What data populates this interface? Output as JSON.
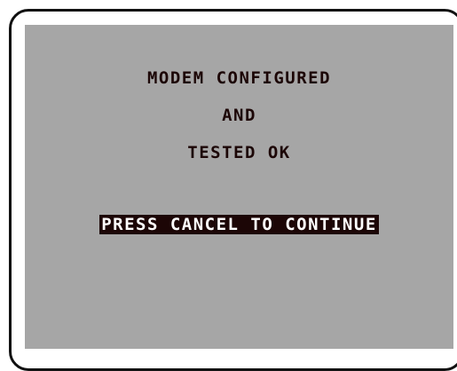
{
  "screen": {
    "lines": [
      "MODEM CONFIGURED",
      "AND",
      "TESTED OK"
    ],
    "prompt": "PRESS CANCEL TO CONTINUE"
  },
  "colors": {
    "screen_background": "#a6a6a6",
    "text": "#1c0606",
    "highlight_background": "#1c0606",
    "highlight_text": "#ffffff",
    "bezel": "#111111"
  }
}
